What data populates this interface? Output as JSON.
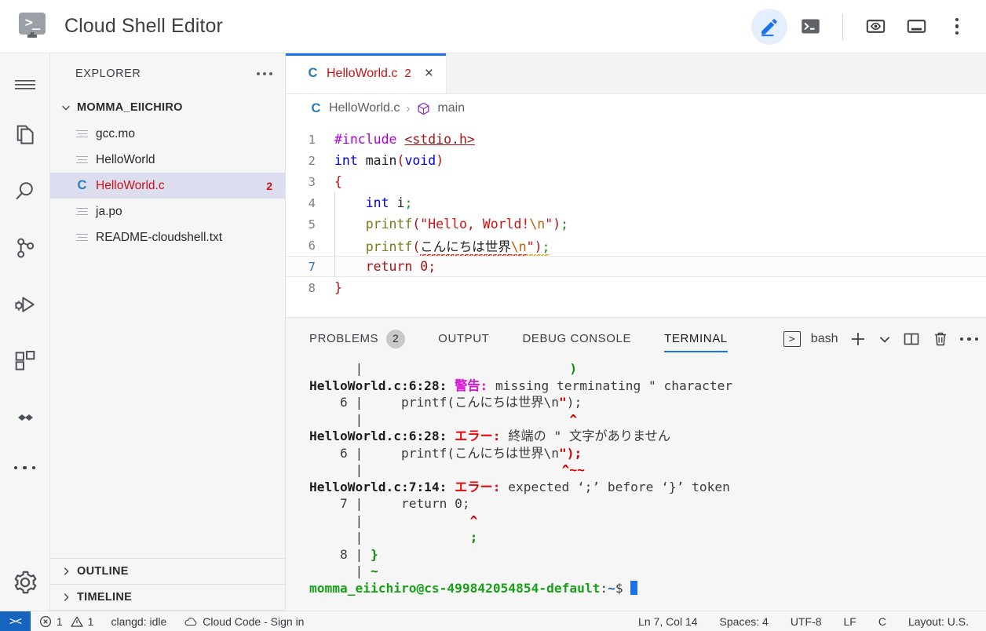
{
  "titlebar": {
    "app_title": "Cloud Shell Editor",
    "logo_glyph": ">_",
    "actions": [
      {
        "name": "edit-button",
        "icon": "pencil-icon",
        "active": true
      },
      {
        "name": "terminal-button",
        "icon": "terminal-icon",
        "active": false
      },
      {
        "name": "preview-button",
        "icon": "web-preview-icon",
        "active": false
      },
      {
        "name": "panel-toggle-button",
        "icon": "panel-layout-icon",
        "active": false
      },
      {
        "name": "more-button",
        "icon": "kebab-menu-icon",
        "active": false
      }
    ]
  },
  "activitybar": {
    "items": [
      {
        "label": "Menu",
        "icon": "hamburger-menu-icon"
      },
      {
        "label": "Explorer",
        "icon": "files-icon"
      },
      {
        "label": "Search",
        "icon": "search-icon"
      },
      {
        "label": "Source Control",
        "icon": "source-control-icon"
      },
      {
        "label": "Run and Debug",
        "icon": "run-debug-icon"
      },
      {
        "label": "Extensions",
        "icon": "extensions-icon"
      },
      {
        "label": "Cloud Code",
        "icon": "cloud-code-icon"
      },
      {
        "label": "More",
        "icon": "ellipsis-icon"
      },
      {
        "label": "Settings",
        "icon": "gear-icon"
      }
    ]
  },
  "sidebar": {
    "title": "EXPLORER",
    "folder": "MOMMA_EIICHIRO",
    "files": [
      {
        "name": "gcc.mo",
        "icon": "generic-file-icon",
        "error": false,
        "badge": ""
      },
      {
        "name": "HelloWorld",
        "icon": "generic-file-icon",
        "error": false,
        "badge": ""
      },
      {
        "name": "HelloWorld.c",
        "icon": "c-file-icon",
        "error": true,
        "badge": "2",
        "selected": true
      },
      {
        "name": "ja.po",
        "icon": "generic-file-icon",
        "error": false,
        "badge": ""
      },
      {
        "name": "README-cloudshell.txt",
        "icon": "generic-file-icon",
        "error": false,
        "badge": ""
      }
    ],
    "sections": [
      {
        "label": "OUTLINE"
      },
      {
        "label": "TIMELINE"
      }
    ]
  },
  "editor": {
    "tab": {
      "icon": "c-file-icon",
      "icon_letter": "C",
      "filename": "HelloWorld.c",
      "problem_count": "2",
      "close": "×"
    },
    "breadcrumb": {
      "icon_letter": "C",
      "file": "HelloWorld.c",
      "separator": "›",
      "symbol_icon": "symbol-method-icon",
      "symbol": "main"
    },
    "current_line": 7,
    "lines": [
      {
        "n": "1",
        "tokens": [
          {
            "t": "#include ",
            "c": "k-pre"
          },
          {
            "t": "<stdio.h>",
            "c": "k-inc"
          }
        ]
      },
      {
        "n": "2",
        "tokens": [
          {
            "t": "int ",
            "c": "k-type"
          },
          {
            "t": "main",
            "c": "k-fnname"
          },
          {
            "t": "(",
            "c": "k-punc"
          },
          {
            "t": "void",
            "c": "k-type"
          },
          {
            "t": ")",
            "c": "k-punc"
          }
        ]
      },
      {
        "n": "3",
        "tokens": [
          {
            "t": "{",
            "c": "k-brace"
          }
        ]
      },
      {
        "n": "4",
        "tokens": [
          {
            "t": "    ",
            "c": "k-plain"
          },
          {
            "t": "int ",
            "c": "k-type"
          },
          {
            "t": "i",
            "c": "k-plain"
          },
          {
            "t": ";",
            "c": "k-semi"
          }
        ]
      },
      {
        "n": "5",
        "tokens": [
          {
            "t": "    ",
            "c": "k-plain"
          },
          {
            "t": "printf",
            "c": "k-call"
          },
          {
            "t": "(",
            "c": "k-punc"
          },
          {
            "t": "\"Hello, World!",
            "c": "k-str"
          },
          {
            "t": "\\n",
            "c": "k-esc"
          },
          {
            "t": "\"",
            "c": "k-str"
          },
          {
            "t": ")",
            "c": "k-punc"
          },
          {
            "t": ";",
            "c": "k-semi"
          }
        ]
      },
      {
        "n": "6",
        "tokens": [
          {
            "t": "    ",
            "c": "k-plain"
          },
          {
            "t": "printf",
            "c": "k-call"
          },
          {
            "t": "(",
            "c": "k-punc"
          },
          {
            "t": "こんにちは世界",
            "c": "k-plain squig-red"
          },
          {
            "t": "\\n",
            "c": "k-esc squig-red"
          },
          {
            "t": "\"",
            "c": "k-str squig-orange"
          },
          {
            "t": ")",
            "c": "k-punc squig-orange"
          },
          {
            "t": ";",
            "c": "k-semi squig-orange"
          }
        ]
      },
      {
        "n": "7",
        "tokens": [
          {
            "t": "    ",
            "c": "k-plain"
          },
          {
            "t": "return ",
            "c": "k-ret"
          },
          {
            "t": "0",
            "c": "k-num"
          },
          {
            "t": ";",
            "c": "k-num"
          }
        ]
      },
      {
        "n": "8",
        "tokens": [
          {
            "t": "}",
            "c": "k-brace"
          }
        ]
      }
    ]
  },
  "panel": {
    "tabs": [
      {
        "label": "PROBLEMS",
        "badge": "2",
        "active": false
      },
      {
        "label": "OUTPUT",
        "badge": "",
        "active": false
      },
      {
        "label": "DEBUG CONSOLE",
        "badge": "",
        "active": false
      },
      {
        "label": "TERMINAL",
        "badge": "",
        "active": true
      }
    ],
    "shell_name": "bash",
    "shell_icon": "terminal-chevron-icon",
    "actions": [
      {
        "name": "new-terminal-button",
        "icon": "plus-icon"
      },
      {
        "name": "terminal-dropdown-button",
        "icon": "chevron-down-icon"
      },
      {
        "name": "split-terminal-button",
        "icon": "split-panel-icon"
      },
      {
        "name": "kill-terminal-button",
        "icon": "trash-icon"
      },
      {
        "name": "terminal-more-button",
        "icon": "ellipsis-icon"
      }
    ],
    "terminal_lines": [
      [
        {
          "t": "      |                           ",
          "c": "t-dim"
        },
        {
          "t": ")",
          "c": "t-green"
        }
      ],
      [
        {
          "t": "HelloWorld.c:6:28: ",
          "c": "t-bold"
        },
        {
          "t": "警告:",
          "c": "t-warn"
        },
        {
          "t": " missing terminating \" character",
          "c": "t-dim"
        }
      ],
      [
        {
          "t": "    6 |     printf(こんにちは世界\\n",
          "c": "t-dim"
        },
        {
          "t": "\"",
          "c": "t-red"
        },
        {
          "t": ");",
          "c": "t-dim"
        }
      ],
      [
        {
          "t": "      |                           ",
          "c": "t-dim"
        },
        {
          "t": "^",
          "c": "t-red"
        }
      ],
      [
        {
          "t": "HelloWorld.c:6:28: ",
          "c": "t-bold"
        },
        {
          "t": "エラー:",
          "c": "t-err"
        },
        {
          "t": " 終端の \" 文字がありません",
          "c": "t-dim"
        }
      ],
      [
        {
          "t": "    6 |     printf(こんにちは世界\\n",
          "c": "t-dim"
        },
        {
          "t": "\");",
          "c": "t-red"
        }
      ],
      [
        {
          "t": "      |                          ",
          "c": "t-dim"
        },
        {
          "t": "^~~",
          "c": "t-red"
        }
      ],
      [
        {
          "t": "HelloWorld.c:7:14: ",
          "c": "t-bold"
        },
        {
          "t": "エラー:",
          "c": "t-err"
        },
        {
          "t": " expected ‘;’ before ‘}’ token",
          "c": "t-dim"
        }
      ],
      [
        {
          "t": "    7 |     return 0;",
          "c": "t-dim"
        }
      ],
      [
        {
          "t": "      |              ",
          "c": "t-dim"
        },
        {
          "t": "^",
          "c": "t-red"
        }
      ],
      [
        {
          "t": "      |              ",
          "c": "t-dim"
        },
        {
          "t": ";",
          "c": "t-green"
        }
      ],
      [
        {
          "t": "    8 | ",
          "c": "t-dim"
        },
        {
          "t": "}",
          "c": "t-green"
        }
      ],
      [
        {
          "t": "      | ",
          "c": "t-dim"
        },
        {
          "t": "~",
          "c": "t-green"
        }
      ]
    ],
    "prompt": {
      "user_host": "momma_eiichiro@cs-499842054854-default",
      "colon": ":",
      "path": "~",
      "sigil": "$"
    }
  },
  "statusbar": {
    "remote_icon": "remote-connection-icon",
    "remote_label": "><",
    "left": [
      {
        "name": "status-problems",
        "icon": "error-circle-icon",
        "icon2": "warning-triangle-icon",
        "errors": "1",
        "warnings": "1"
      },
      {
        "name": "status-clangd",
        "label": "clangd: idle"
      },
      {
        "name": "status-cloud-code",
        "icon": "cloud-icon",
        "label": "Cloud Code - Sign in"
      }
    ],
    "right": [
      {
        "name": "status-cursor-position",
        "label": "Ln 7, Col 14"
      },
      {
        "name": "status-indentation",
        "label": "Spaces: 4"
      },
      {
        "name": "status-encoding",
        "label": "UTF-8"
      },
      {
        "name": "status-eol",
        "label": "LF"
      },
      {
        "name": "status-language",
        "label": "C"
      },
      {
        "name": "status-keyboard-layout",
        "label": "Layout: U.S."
      }
    ]
  },
  "colors": {
    "accent_blue": "#1a73e8",
    "error_red": "#cc1212",
    "remote_blue": "#1565c0",
    "panel_bg": "#f6f6f6"
  }
}
